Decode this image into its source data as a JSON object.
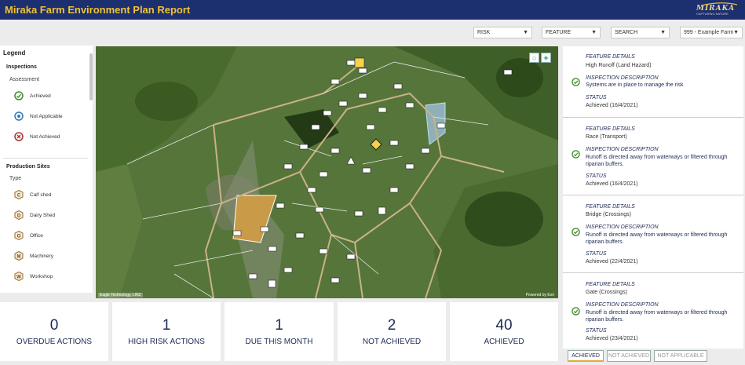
{
  "header": {
    "title": "Miraka Farm Environment Plan Report",
    "logo_text": "MIRAKA",
    "logo_tag": "CAPTURING NATURE"
  },
  "filters": {
    "risk": "RISK",
    "feature": "FEATURE",
    "search": "SEARCH",
    "farm": "999 - Example Farm"
  },
  "legend": {
    "title": "Legend",
    "inspections": {
      "heading": "Inspections",
      "subheading": "Assessment",
      "items": [
        "Achieved",
        "Not Applicable",
        "Not Achieved"
      ]
    },
    "production_sites": {
      "heading": "Production Sites",
      "subheading": "Type",
      "items": [
        "Calf shed",
        "Dairy Shed",
        "Office",
        "Machinery",
        "Workshop"
      ]
    },
    "icon_letters": [
      "C",
      "D",
      "O",
      "M",
      "W"
    ]
  },
  "map": {
    "attribution_left": "Eagle Technology, LINZ",
    "attribution_right": "Powered by Esri",
    "home_icon": "home-icon",
    "layers_icon": "layers-icon"
  },
  "stats": [
    {
      "value": "0",
      "label": "OVERDUE ACTIONS"
    },
    {
      "value": "1",
      "label": "HIGH RISK ACTIONS"
    },
    {
      "value": "1",
      "label": "DUE THIS MONTH"
    },
    {
      "value": "2",
      "label": "NOT ACHIEVED"
    },
    {
      "value": "40",
      "label": "ACHIEVED"
    }
  ],
  "panel": {
    "labels": {
      "feature": "FEATURE DETAILS",
      "inspection": "INSPECTION DESCRIPTION",
      "status": "STATUS"
    },
    "cards": [
      {
        "feature": "High Runoff (Land Hazard)",
        "inspection": "Systems are in place to manage the risk",
        "status": "Achieved (16/4/2021)"
      },
      {
        "feature": "Race (Transport)",
        "inspection": "Runoff is directed away from waterways or filtered through riparian buffers.",
        "status": "Achieved (16/4/2021)"
      },
      {
        "feature": "Bridge (Crossings)",
        "inspection": "Runoff is directed away from waterways or filtered through riparian buffers.",
        "status": "Achieved (22/4/2021)"
      },
      {
        "feature": "Gate (Crossings)",
        "inspection": "Runoff is directed away from waterways or filtered through riparian buffers.",
        "status": "Achieved (23/4/2021)"
      }
    ]
  },
  "tabs": [
    "ACHIEVED",
    "NOT ACHIEVED",
    "NOT APPLICABLE"
  ],
  "colors": {
    "header": "#1c2f6e",
    "title": "#f2c232",
    "achieved": "#3f8f2c",
    "not_applicable": "#3578b8",
    "not_achieved": "#b03030",
    "site_icon": "#9c6a2e"
  }
}
